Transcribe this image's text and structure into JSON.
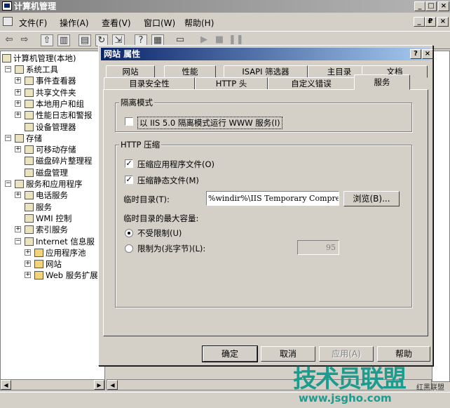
{
  "window": {
    "title": "计算机管理",
    "min": "_",
    "max": "□",
    "close": "×"
  },
  "child_controls": {
    "min": "_",
    "restore": "₽",
    "close": "×"
  },
  "menu": [
    "文件(F)",
    "操作(A)",
    "查看(V)",
    "窗口(W)",
    "帮助(H)"
  ],
  "tree": {
    "root": "计算机管理(本地)",
    "items": [
      {
        "label": "系统工具",
        "level": 1,
        "expander": "−"
      },
      {
        "label": "事件查看器",
        "level": 2,
        "expander": "+"
      },
      {
        "label": "共享文件夹",
        "level": 2,
        "expander": "+"
      },
      {
        "label": "本地用户和组",
        "level": 2,
        "expander": "+"
      },
      {
        "label": "性能日志和警报",
        "level": 2,
        "expander": "+"
      },
      {
        "label": "设备管理器",
        "level": 2,
        "expander": ""
      },
      {
        "label": "存储",
        "level": 1,
        "expander": "−"
      },
      {
        "label": "可移动存储",
        "level": 2,
        "expander": "+"
      },
      {
        "label": "磁盘碎片整理程",
        "level": 2,
        "expander": ""
      },
      {
        "label": "磁盘管理",
        "level": 2,
        "expander": ""
      },
      {
        "label": "服务和应用程序",
        "level": 1,
        "expander": "−"
      },
      {
        "label": "电话服务",
        "level": 2,
        "expander": "+"
      },
      {
        "label": "服务",
        "level": 2,
        "expander": ""
      },
      {
        "label": "WMI 控制",
        "level": 2,
        "expander": ""
      },
      {
        "label": "索引服务",
        "level": 2,
        "expander": "+"
      },
      {
        "label": "Internet 信息服",
        "level": 2,
        "expander": "−"
      },
      {
        "label": "应用程序池",
        "level": 3,
        "expander": "+"
      },
      {
        "label": "网站",
        "level": 3,
        "expander": "+"
      },
      {
        "label": "Web 服务扩展",
        "level": 3,
        "expander": "+"
      }
    ]
  },
  "dialog": {
    "title": "网站 属性",
    "help": "?",
    "close": "×",
    "tabs_back": [
      "网站",
      "性能",
      "ISAPI 筛选器",
      "主目录",
      "文档"
    ],
    "tabs_front": [
      "目录安全性",
      "HTTP 头",
      "自定义错误",
      "服务"
    ],
    "isolation": {
      "group_label": "隔离模式",
      "checkbox_label": "以 IIS 5.0 隔离模式运行 WWW 服务(I)",
      "checked": false
    },
    "compression": {
      "group_label": "HTTP 压缩",
      "app_files_label": "压缩应用程序文件(O)",
      "app_files_checked": true,
      "static_files_label": "压缩静态文件(M)",
      "static_files_checked": true,
      "temp_dir_label": "临时目录(T):",
      "temp_dir_value": "%windir%\\IIS Temporary Compres",
      "browse_label": "浏览(B)...",
      "max_size_label": "临时目录的最大容量:",
      "unlimited_label": "不受限制(U)",
      "limited_label": "限制为(兆字节)(L):",
      "selected": "unlimited",
      "limit_value": "95"
    },
    "buttons": {
      "ok": "确定",
      "cancel": "取消",
      "apply": "应用(A)",
      "help": "帮助"
    }
  },
  "watermark": {
    "main": "技术员联盟",
    "url": "www.jsgho.com",
    "corner": "红黑联盟"
  },
  "colors": {
    "dialog_title": "#0a246a",
    "face": "#d4d0c8",
    "watermark": "#1c9b8f"
  }
}
